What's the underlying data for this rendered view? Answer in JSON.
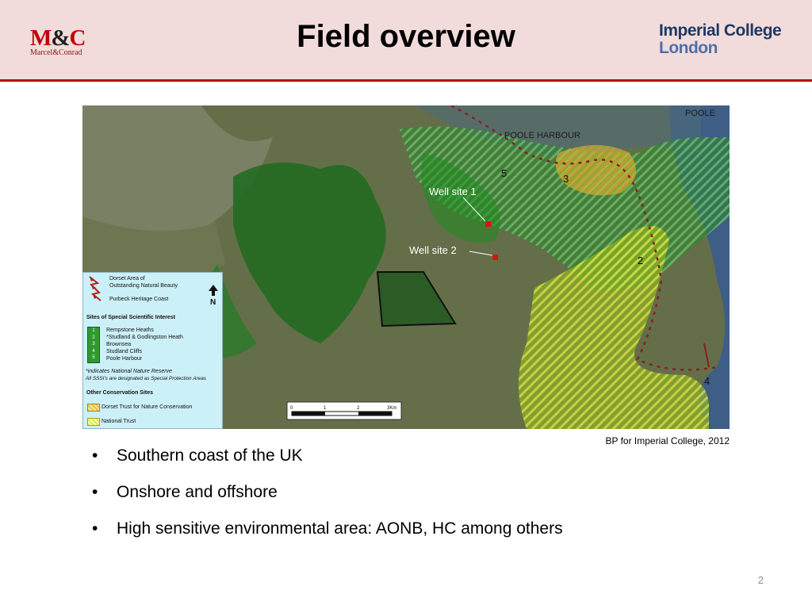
{
  "header": {
    "title": "Field overview",
    "left_logo": {
      "main": "M&C",
      "main_part1": "M",
      "main_amp": "&",
      "main_part2": "C",
      "subtitle": "Marcel&Conrad",
      "color": "#c00000"
    },
    "right_logo": {
      "line1": "Imperial College",
      "line2": "London",
      "color": "#1f3864"
    },
    "accent_color": "#c00000",
    "background_color": "#f2dcdb"
  },
  "map": {
    "labels": {
      "poole": "POOLE",
      "poole_harbour": "POOLE HARBOUR",
      "well_site_1": "Well site 1",
      "well_site_2": "Well site 2",
      "area_3": "3",
      "area_5": "5",
      "area_2": "2",
      "area_4": "4"
    },
    "scale_bar": {
      "ticks": [
        "0",
        "1",
        "2",
        "3Km"
      ]
    },
    "legend": {
      "aonb": "Dorset Area of Outstanding Natural Beauty",
      "aonb_line1": "Dorset Area of",
      "aonb_line2": "Outstanding Natural Beauty",
      "heritage_coast": "Purbeck Heritage Coast",
      "north": "N",
      "sssi_heading": "Sites of Special Scientific Interest",
      "sssi_items": [
        {
          "num": "1",
          "label": "Rempstone Heaths"
        },
        {
          "num": "2",
          "label": "*Studland & Godlingston Heath"
        },
        {
          "num": "3",
          "label": "Brownsea"
        },
        {
          "num": "4",
          "label": "Studland Cliffs"
        },
        {
          "num": "5",
          "label": "Poole Harbour"
        }
      ],
      "note1": "*indicates National Nature Reserve",
      "note2": "All SSSI's are designated as Special Protection Areas",
      "other_heading": "Other Conservation Sites",
      "other_items": [
        {
          "label": "Dorset Trust for Nature Conservation",
          "color": "#e8c040"
        },
        {
          "label": "National Trust",
          "color": "#e8e840"
        }
      ]
    },
    "colors": {
      "sssi": "#1f8a1f",
      "aonb": "#8a1f1f",
      "trust": "#d8d830"
    }
  },
  "credit": "BP for Imperial College, 2012",
  "bullets": [
    "Southern coast of the UK",
    "Onshore and offshore",
    "High sensitive environmental area: AONB, HC among others"
  ],
  "bullet_glyph": "•",
  "page_number": "2"
}
